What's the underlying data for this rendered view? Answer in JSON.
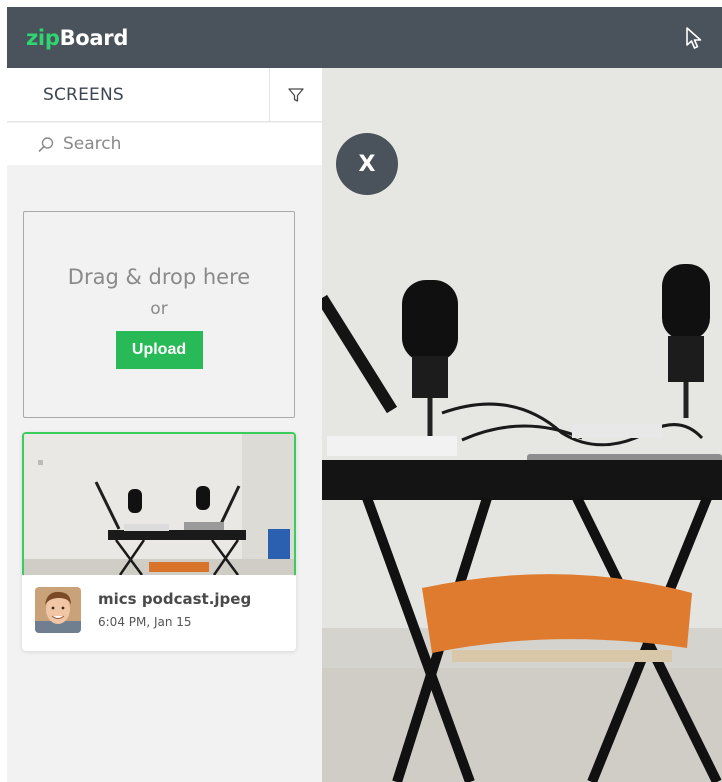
{
  "header": {
    "logo_zip": "zip",
    "logo_board": "Board",
    "cursor_icon": "pointer-cursor-icon",
    "bg_color": "#4a525c",
    "accent_color": "#2fd66f"
  },
  "sidebar": {
    "tab_label": "SCREENS",
    "filter_icon": "filter-icon",
    "search": {
      "placeholder": "Search",
      "icon": "search-icon"
    },
    "dropzone": {
      "text": "Drag & drop here",
      "or": "or",
      "upload_label": "Upload"
    },
    "screens": [
      {
        "name": "mics podcast.jpeg",
        "time": "6:04 PM, Jan 15"
      }
    ]
  },
  "viewer": {
    "close_label": "X"
  },
  "colors": {
    "upload_green": "#27ba56",
    "selected_border": "#3ccc5c"
  }
}
